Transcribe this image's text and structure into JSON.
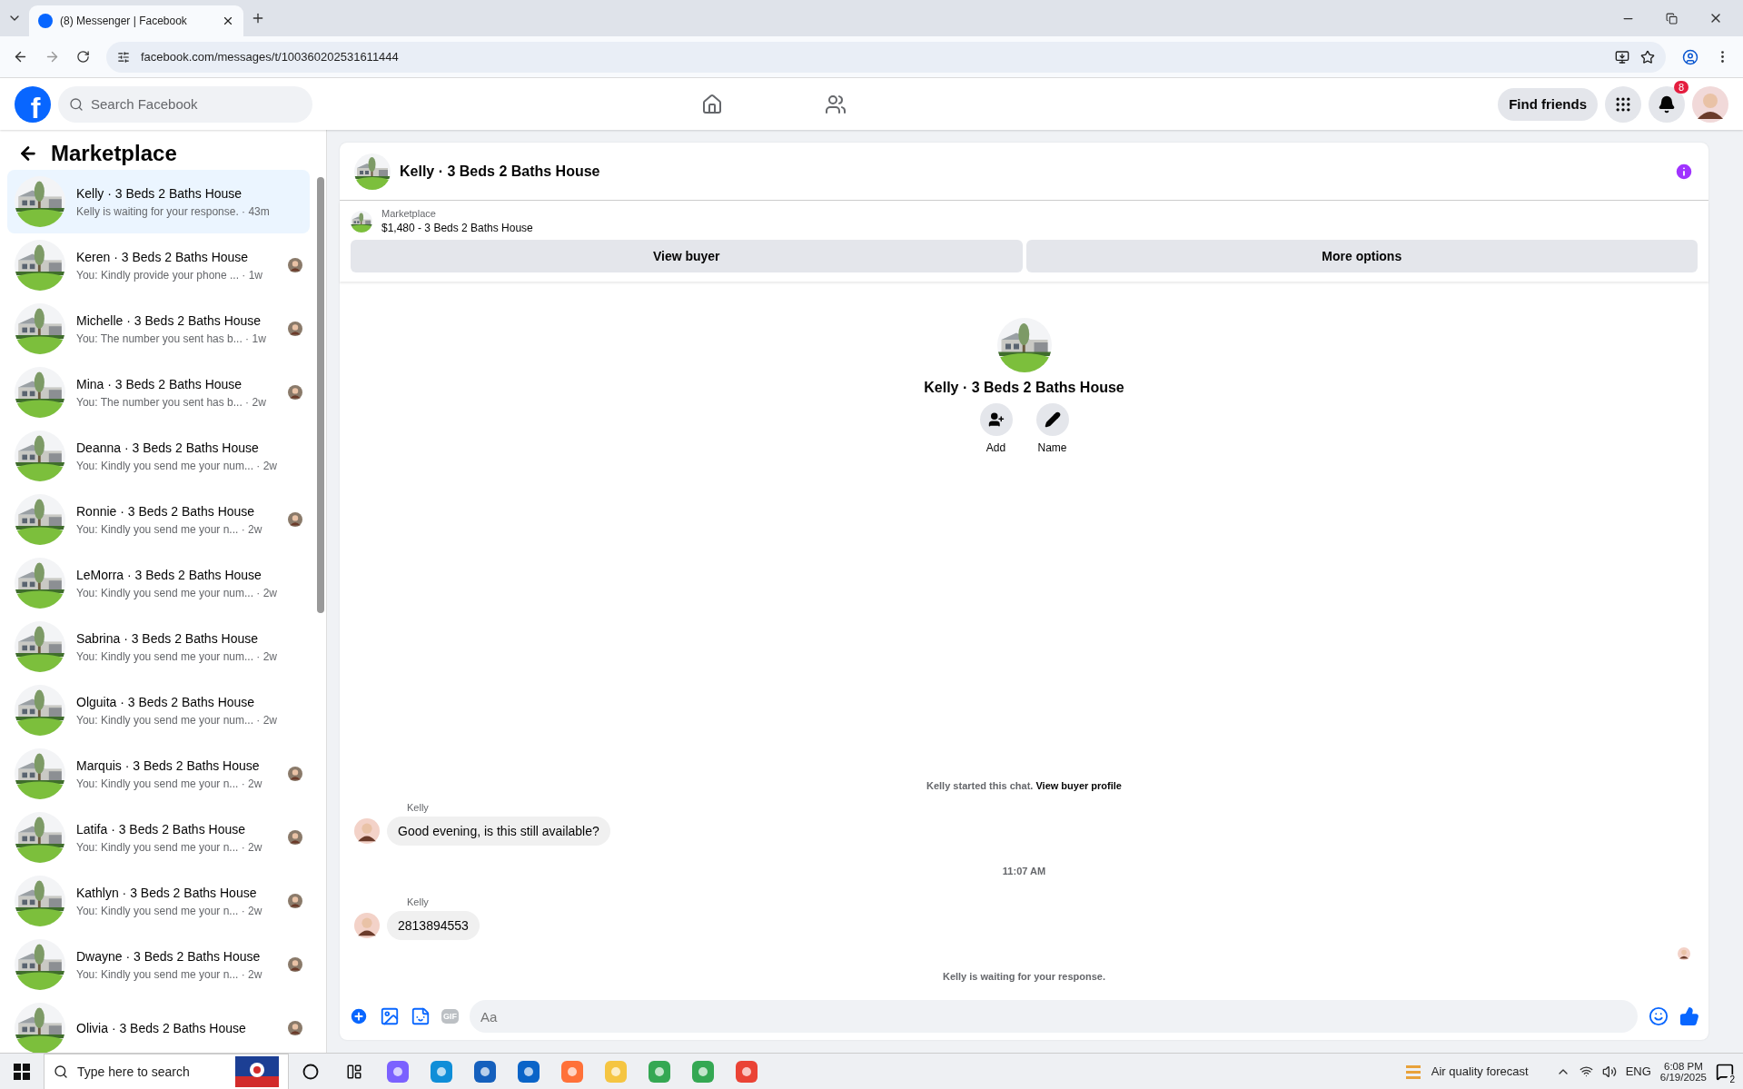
{
  "browser": {
    "tab_title": "(8) Messenger | Facebook",
    "url": "facebook.com/messages/t/100360202531611444"
  },
  "header": {
    "logo_letter": "f",
    "search_placeholder": "Search Facebook",
    "find_friends": "Find friends",
    "notification_count": "8"
  },
  "sidebar": {
    "title": "Marketplace",
    "conversations": [
      {
        "title": "Kelly · 3 Beds 2 Baths House",
        "preview": "Kelly is waiting for your response. · 43m",
        "selected": true,
        "seen": false
      },
      {
        "title": "Keren · 3 Beds 2 Baths House",
        "preview": "You: Kindly provide your phone ... · 1w",
        "selected": false,
        "seen": true
      },
      {
        "title": "Michelle · 3 Beds 2 Baths House",
        "preview": "You: The number you sent has b... · 1w",
        "selected": false,
        "seen": true
      },
      {
        "title": "Mina · 3 Beds 2 Baths House",
        "preview": "You: The number you sent has b... · 2w",
        "selected": false,
        "seen": true
      },
      {
        "title": "Deanna · 3 Beds 2 Baths House",
        "preview": "You: Kindly you send me your num... · 2w",
        "selected": false,
        "seen": false
      },
      {
        "title": "Ronnie · 3 Beds 2 Baths House",
        "preview": "You: Kindly you send me your n... · 2w",
        "selected": false,
        "seen": true
      },
      {
        "title": "LeMorra · 3 Beds 2 Baths House",
        "preview": "You: Kindly you send me your num... · 2w",
        "selected": false,
        "seen": false
      },
      {
        "title": "Sabrina · 3 Beds 2 Baths House",
        "preview": "You: Kindly you send me your num... · 2w",
        "selected": false,
        "seen": false
      },
      {
        "title": "Olguita · 3 Beds 2 Baths House",
        "preview": "You: Kindly you send me your num... · 2w",
        "selected": false,
        "seen": false
      },
      {
        "title": "Marquis · 3 Beds 2 Baths House",
        "preview": "You: Kindly you send me your n... · 2w",
        "selected": false,
        "seen": true
      },
      {
        "title": "Latifa · 3 Beds 2 Baths House",
        "preview": "You: Kindly you send me your n... · 2w",
        "selected": false,
        "seen": true
      },
      {
        "title": "Kathlyn · 3 Beds 2 Baths House",
        "preview": "You: Kindly you send me your n... · 2w",
        "selected": false,
        "seen": true
      },
      {
        "title": "Dwayne · 3 Beds 2 Baths House",
        "preview": "You: Kindly you send me your n... · 2w",
        "selected": false,
        "seen": true
      },
      {
        "title": "Olivia · 3 Beds 2 Baths House",
        "selected": false,
        "seen": true
      }
    ]
  },
  "chat": {
    "title": "Kelly · 3 Beds 2 Baths House",
    "listing": {
      "source": "Marketplace",
      "summary": "$1,480 - 3 Beds 2 Baths House"
    },
    "buttons": [
      "View buyer",
      "More options"
    ],
    "profile": {
      "name": "Kelly · 3 Beds 2 Baths House",
      "actions": [
        {
          "kind": "add",
          "label": "Add"
        },
        {
          "kind": "name",
          "label": "Name"
        }
      ]
    },
    "started": {
      "text": "Kelly started this chat.",
      "link": "View buyer profile"
    },
    "messages": [
      {
        "kind": "message",
        "sender": "Kelly",
        "text": "Good evening, is this still available?"
      },
      {
        "kind": "time",
        "text": "11:07 AM"
      },
      {
        "kind": "message",
        "sender": "Kelly",
        "text": "2813894553"
      }
    ],
    "status": "Kelly is waiting for your response.",
    "composer": {
      "gif_label": "GIF",
      "placeholder": "Aa"
    }
  },
  "taskbar": {
    "search_placeholder": "Type here to search",
    "weather": "Air quality forecast",
    "language": "ENG",
    "time": "6:08 PM",
    "date": "6/19/2025",
    "notification_count": "2"
  }
}
